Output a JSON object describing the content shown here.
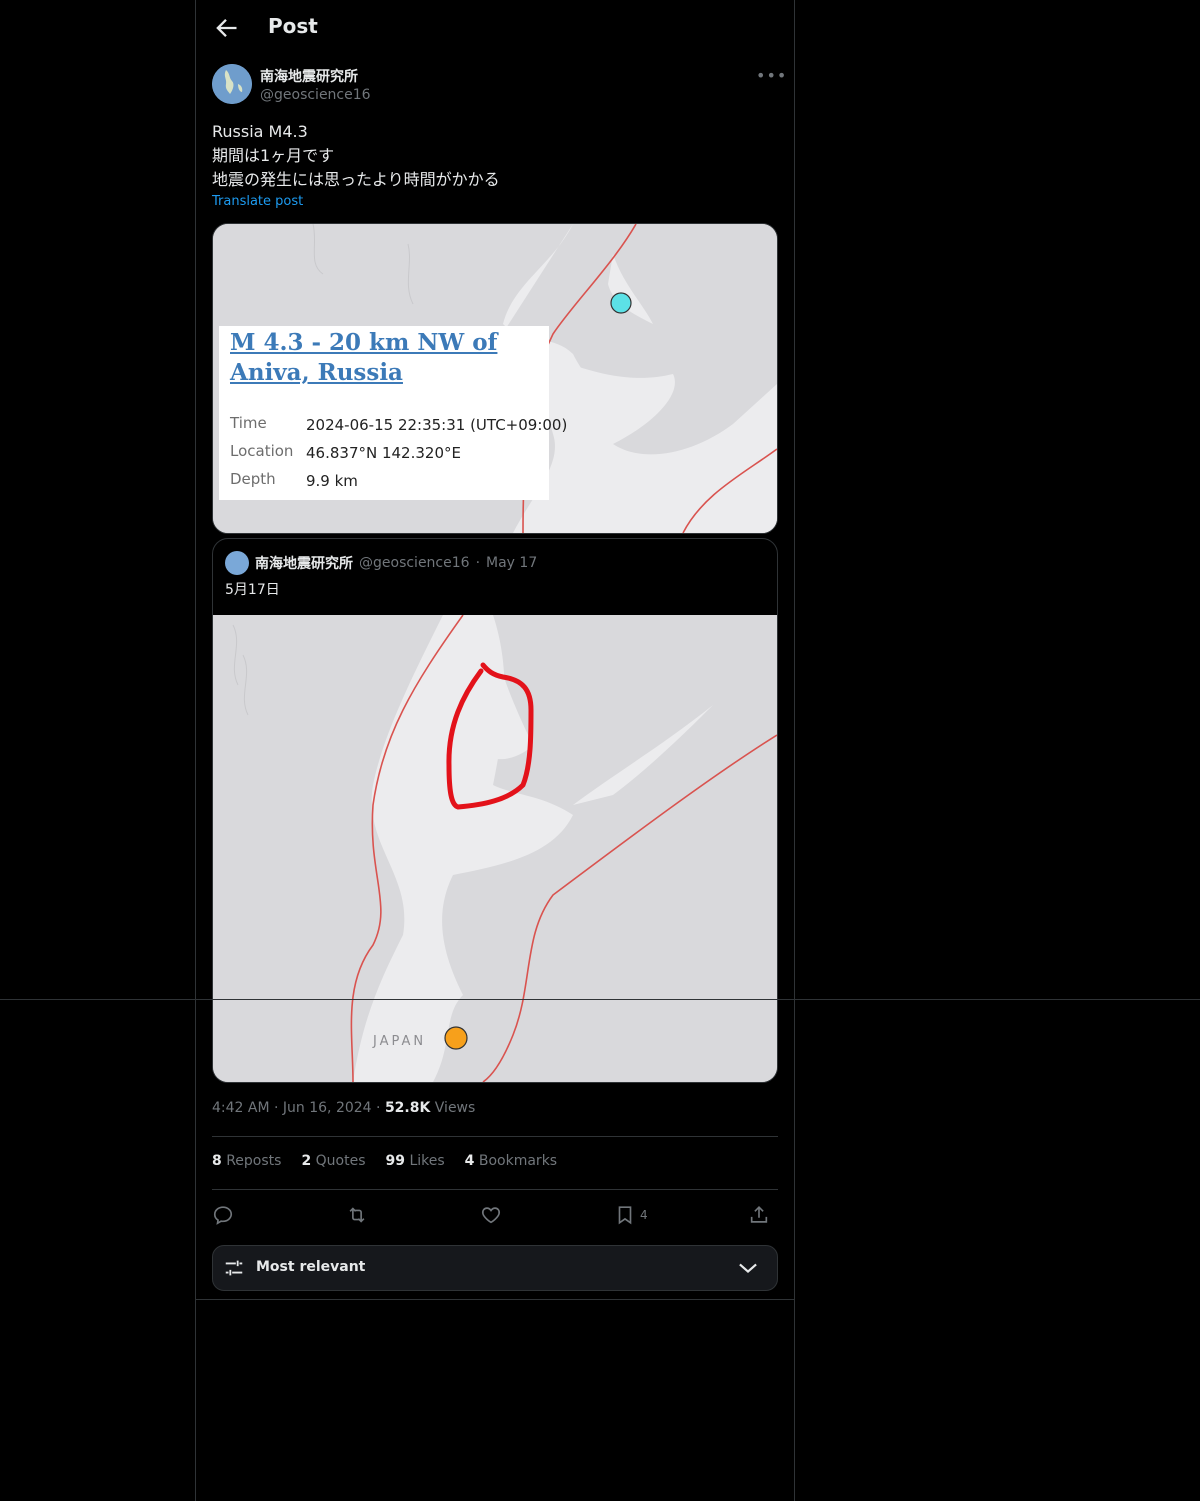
{
  "header": {
    "title": "Post"
  },
  "author": {
    "name": "南海地震研究所",
    "handle": "@geoscience16"
  },
  "post": {
    "lines": [
      "Russia M4.3",
      "期間は1ヶ月です",
      "地震の発生には思ったより時間がかかる"
    ],
    "translate_label": "Translate post"
  },
  "card": {
    "title": "M 4.3 - 20 km NW of Aniva, Russia",
    "rows": [
      {
        "key": "Time",
        "value": "2024-06-15 22:35:31 (UTC+09:00)"
      },
      {
        "key": "Location",
        "value": "46.837°N 142.320°E"
      },
      {
        "key": "Depth",
        "value": "9.9 km"
      }
    ]
  },
  "quote": {
    "name": "南海地震研究所",
    "handle": "@geoscience16",
    "dot": "·",
    "date": "May 17",
    "text": "5月17日",
    "map_label": "JAPAN"
  },
  "meta": {
    "time": "4:42 AM",
    "dot1": "·",
    "date": "Jun 16, 2024",
    "dot2": "·",
    "views": "52.8K",
    "views_label": "Views"
  },
  "stats": {
    "reposts": "8",
    "reposts_label": "Reposts",
    "quotes": "2",
    "quotes_label": "Quotes",
    "likes": "99",
    "likes_label": "Likes",
    "bookmarks": "4",
    "bookmarks_label": "Bookmarks"
  },
  "actions": {
    "bookmark_count": "4"
  },
  "filter": {
    "label": "Most relevant"
  },
  "colors": {
    "accent": "#1d9bf0",
    "bg": "#000000",
    "text": "#e7e9ea",
    "muted": "#71767b",
    "border": "#2f3336"
  }
}
